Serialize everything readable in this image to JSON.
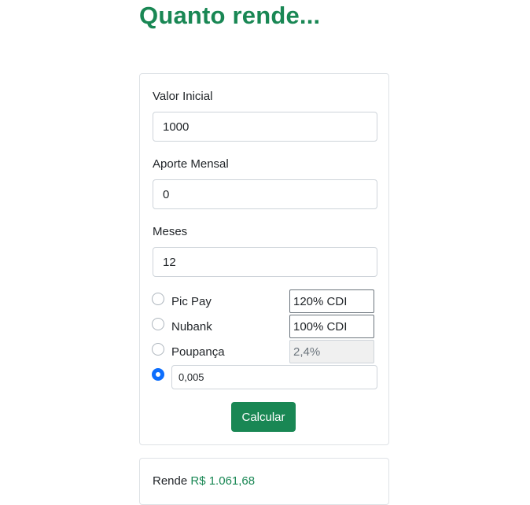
{
  "page": {
    "title": "Quanto rende..."
  },
  "form": {
    "valor_inicial": {
      "label": "Valor Inicial",
      "value": "1000"
    },
    "aporte_mensal": {
      "label": "Aporte Mensal",
      "value": "0"
    },
    "meses": {
      "label": "Meses",
      "value": "12"
    },
    "options": [
      {
        "label": "Pic Pay",
        "rate": "120% CDI",
        "checked": false,
        "disabled": false
      },
      {
        "label": "Nubank",
        "rate": "100% CDI",
        "checked": false,
        "disabled": false
      },
      {
        "label": "Poupança",
        "rate": "2,4%",
        "checked": false,
        "disabled": true
      }
    ],
    "custom": {
      "value": "0,005",
      "checked": true
    },
    "submit_label": "Calcular"
  },
  "result": {
    "prefix": "Rende",
    "value": "R$ 1.061,68"
  },
  "colors": {
    "accent": "#198754",
    "radio_checked": "#0d6efd"
  }
}
